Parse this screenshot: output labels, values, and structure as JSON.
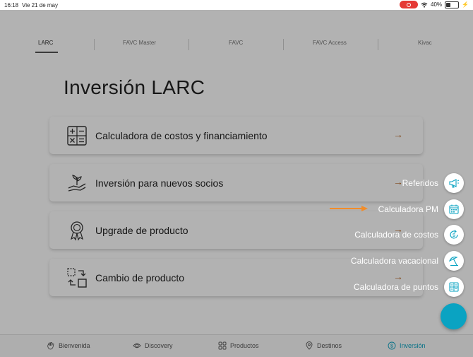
{
  "status": {
    "time": "16:18",
    "date": "Vie 21 de may",
    "battery": "40%",
    "battery_level": 0.4
  },
  "tabs": [
    {
      "label": "LARC",
      "active": true
    },
    {
      "label": "FAVC Master",
      "active": false
    },
    {
      "label": "FAVC",
      "active": false
    },
    {
      "label": "FAVC Access",
      "active": false
    },
    {
      "label": "Kivac",
      "active": false
    }
  ],
  "page_title": "Inversión LARC",
  "cards": [
    {
      "label": "Calculadora de costos y financiamiento",
      "icon": "calculator-icon",
      "arrow": "→"
    },
    {
      "label": "Inversión para nuevos socios",
      "icon": "hand-plant-icon",
      "arrow": "→"
    },
    {
      "label": "Upgrade de producto",
      "icon": "award-icon",
      "arrow": "→"
    },
    {
      "label": "Cambio de producto",
      "icon": "swap-icon",
      "arrow": "→"
    }
  ],
  "fab_menu": [
    {
      "label": "Referidos",
      "icon": "megaphone-icon"
    },
    {
      "label": "Calculadora PM",
      "icon": "calendar-icon"
    },
    {
      "label": "Calculadora de costos",
      "icon": "dollar-cycle-icon"
    },
    {
      "label": "Calculadora vacacional",
      "icon": "beach-umbrella-icon"
    },
    {
      "label": "Calculadora de puntos",
      "icon": "grid-calculator-icon"
    }
  ],
  "bottom_nav": [
    {
      "label": "Bienvenida",
      "icon": "hand-wave-icon",
      "active": false
    },
    {
      "label": "Discovery",
      "icon": "eye-icon",
      "active": false
    },
    {
      "label": "Productos",
      "icon": "grid-icon",
      "active": false
    },
    {
      "label": "Destinos",
      "icon": "location-pin-icon",
      "active": false
    },
    {
      "label": "Inversión",
      "icon": "dollar-circle-icon",
      "active": true
    }
  ],
  "colors": {
    "accent": "#0aa3c2",
    "arrow": "#b96b2a",
    "annotation": "#f28c28",
    "record": "#e53935"
  }
}
